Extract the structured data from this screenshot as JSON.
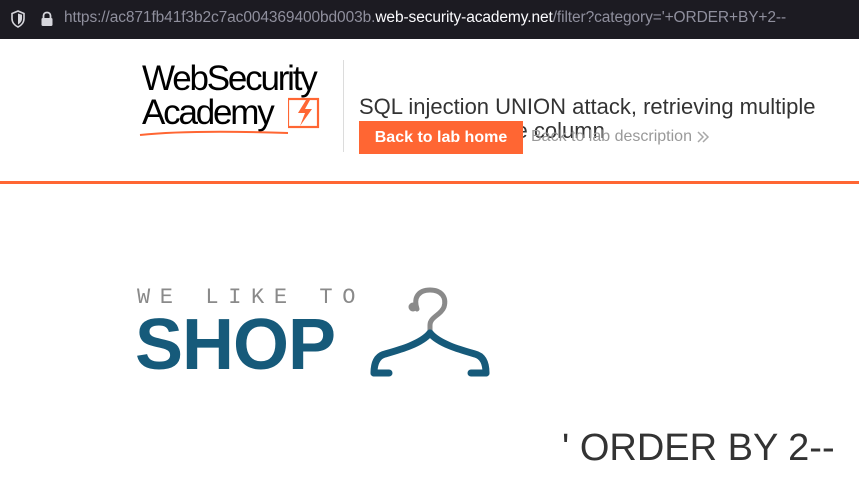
{
  "browser": {
    "url_prefix": "https://ac871fb41f3b2c7ac004369400bd003b.",
    "url_domain": "web-security-academy.net",
    "url_path": "/filter?category='+ORDER+BY+2--",
    "icons": [
      "shield-icon",
      "lock-icon"
    ]
  },
  "header": {
    "logo_line1": "WebSecurity",
    "logo_line2": "Academy",
    "lab_title": "SQL injection UNION attack, retrieving multiple values in a single column",
    "back_home_label": "Back to lab home",
    "back_description_label": "Back to lab description"
  },
  "shop": {
    "tagline": "WE LIKE TO",
    "word": "SHOP"
  },
  "main": {
    "filter_heading": "' ORDER BY 2--"
  },
  "colors": {
    "accent": "#ff6633",
    "shop_blue": "#165a7a",
    "urlbar_bg": "#1c1b22"
  }
}
